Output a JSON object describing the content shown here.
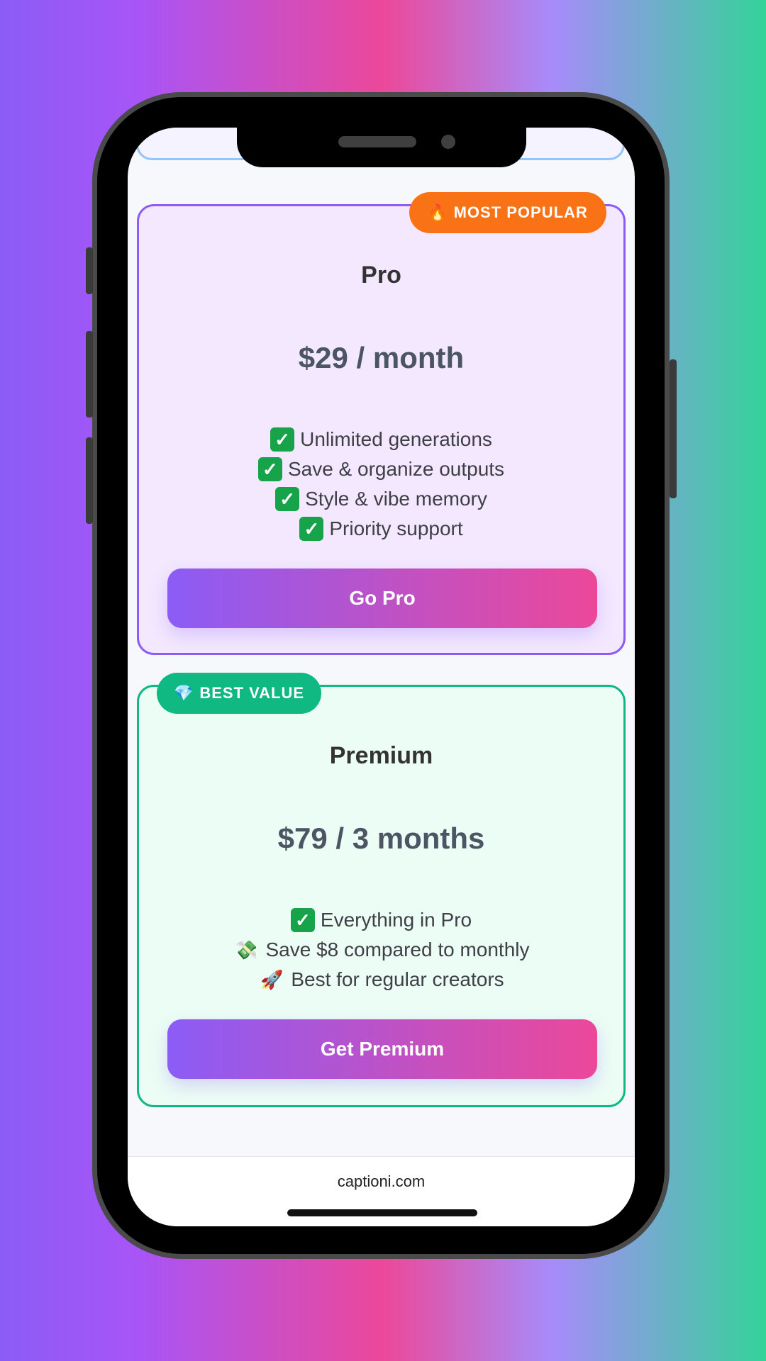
{
  "pro_plan": {
    "badge_icon": "fire-icon",
    "badge_text": "MOST POPULAR",
    "name": "Pro",
    "price": "$29 / month",
    "features": [
      {
        "icon": "check-icon",
        "text": "Unlimited generations"
      },
      {
        "icon": "check-icon",
        "text": "Save & organize outputs"
      },
      {
        "icon": "check-icon",
        "text": "Style & vibe memory"
      },
      {
        "icon": "check-icon",
        "text": "Priority support"
      }
    ],
    "cta": "Go Pro",
    "accent": "#8b5cf6",
    "badge_color": "#f97316"
  },
  "premium_plan": {
    "badge_icon": "gem-icon",
    "badge_text": "BEST VALUE",
    "name": "Premium",
    "price": "$79 / 3 months",
    "features": [
      {
        "icon": "check-icon",
        "text": "Everything in Pro"
      },
      {
        "icon": "money-icon",
        "text": "Save $8 compared to monthly"
      },
      {
        "icon": "rocket-icon",
        "text": "Best for regular creators"
      }
    ],
    "cta": "Get Premium",
    "accent": "#10b981",
    "badge_color": "#10b981"
  },
  "footer": {
    "url": "captioni.com"
  },
  "colors": {
    "cta_gradient_start": "#8b5cf6",
    "cta_gradient_end": "#ec4899"
  }
}
